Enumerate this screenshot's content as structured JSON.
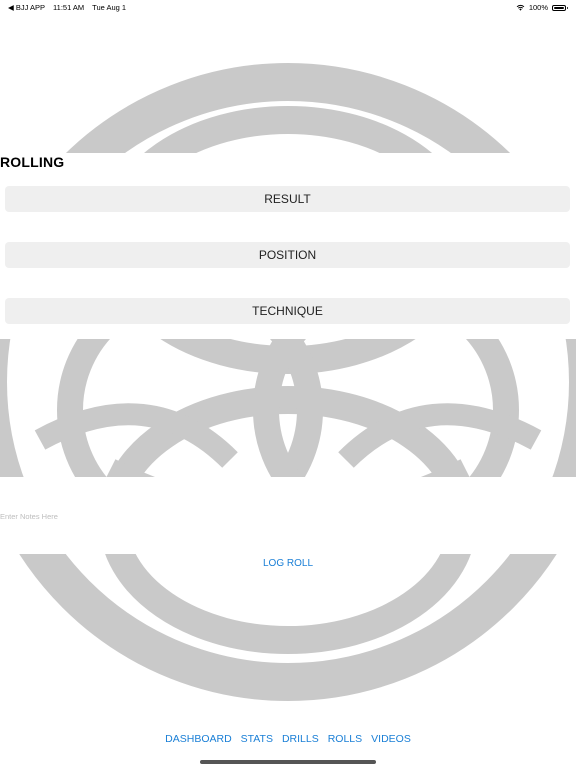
{
  "status_bar": {
    "back_app": "◀ BJJ APP",
    "time": "11:51 AM",
    "date": "Tue Aug 1",
    "battery": "100%",
    "icons": [
      "wifi-icon",
      "battery-icon"
    ]
  },
  "page": {
    "title": "ROLLING"
  },
  "selectors": {
    "result": "RESULT",
    "position": "POSITION",
    "technique": "TECHNIQUE"
  },
  "notes": {
    "placeholder": "Enter Notes Here",
    "value": ""
  },
  "actions": {
    "log_roll": "LOG ROLL"
  },
  "nav": {
    "items": [
      "DASHBOARD",
      "STATS",
      "DRILLS",
      "ROLLS",
      "VIDEOS"
    ]
  },
  "colors": {
    "accent": "#1a7fd6",
    "logo_gray": "#c9c9c9",
    "button_bg": "#efefef"
  }
}
